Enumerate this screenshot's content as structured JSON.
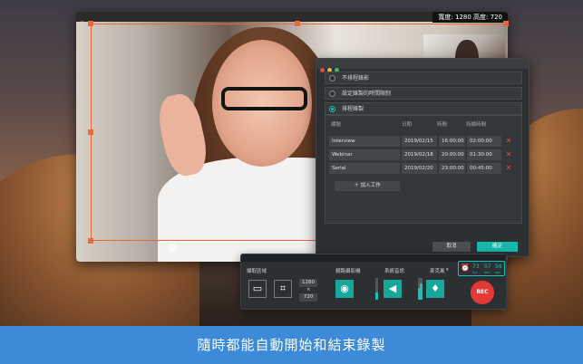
{
  "camera_window": {
    "dimension_readout": "寬度: 1280  高度: 720"
  },
  "schedule_dialog": {
    "options": [
      {
        "label": "不排程錄影",
        "selected": false
      },
      {
        "label": "設定錄製的時間限制",
        "selected": false
      },
      {
        "label": "排程錄製",
        "selected": true
      }
    ],
    "table": {
      "headers": [
        "標題",
        "日期",
        "時間",
        "持續時間"
      ],
      "rows": [
        {
          "title": "Interview",
          "date": "2019/02/15",
          "time": "16:00:00",
          "duration": "02:00:00"
        },
        {
          "title": "Webinar",
          "date": "2019/02/18",
          "time": "20:00:00",
          "duration": "01:30:00"
        },
        {
          "title": "Serial",
          "date": "2019/02/20",
          "time": "23:00:00",
          "duration": "00:45:00"
        }
      ]
    },
    "add_task_label": "＋ 加入工作",
    "cancel_label": "取消",
    "ok_label": "確定"
  },
  "recorder": {
    "capture_area_label": "擷取區域",
    "width_value": "1280",
    "times_sign": "×",
    "height_value": "720",
    "webcam_label": "網路攝影機",
    "system_audio_label": "系統音訊",
    "microphone_label": "麥克風",
    "rec_label": "REC",
    "timer": {
      "hh": "73",
      "mm": "07",
      "ss": "56",
      "hh_unit": "hrs",
      "mm_unit": "min",
      "ss_unit": "sec"
    },
    "levels": {
      "webcam": 0.35,
      "system_audio": 0.55,
      "microphone": 0.75
    }
  },
  "caption": "隨時都能自動開始和結束錄製",
  "colors": {
    "accent": "#19c2b8",
    "record": "#e53935",
    "selection": "#e9683c",
    "banner": "#3d8bd8"
  }
}
